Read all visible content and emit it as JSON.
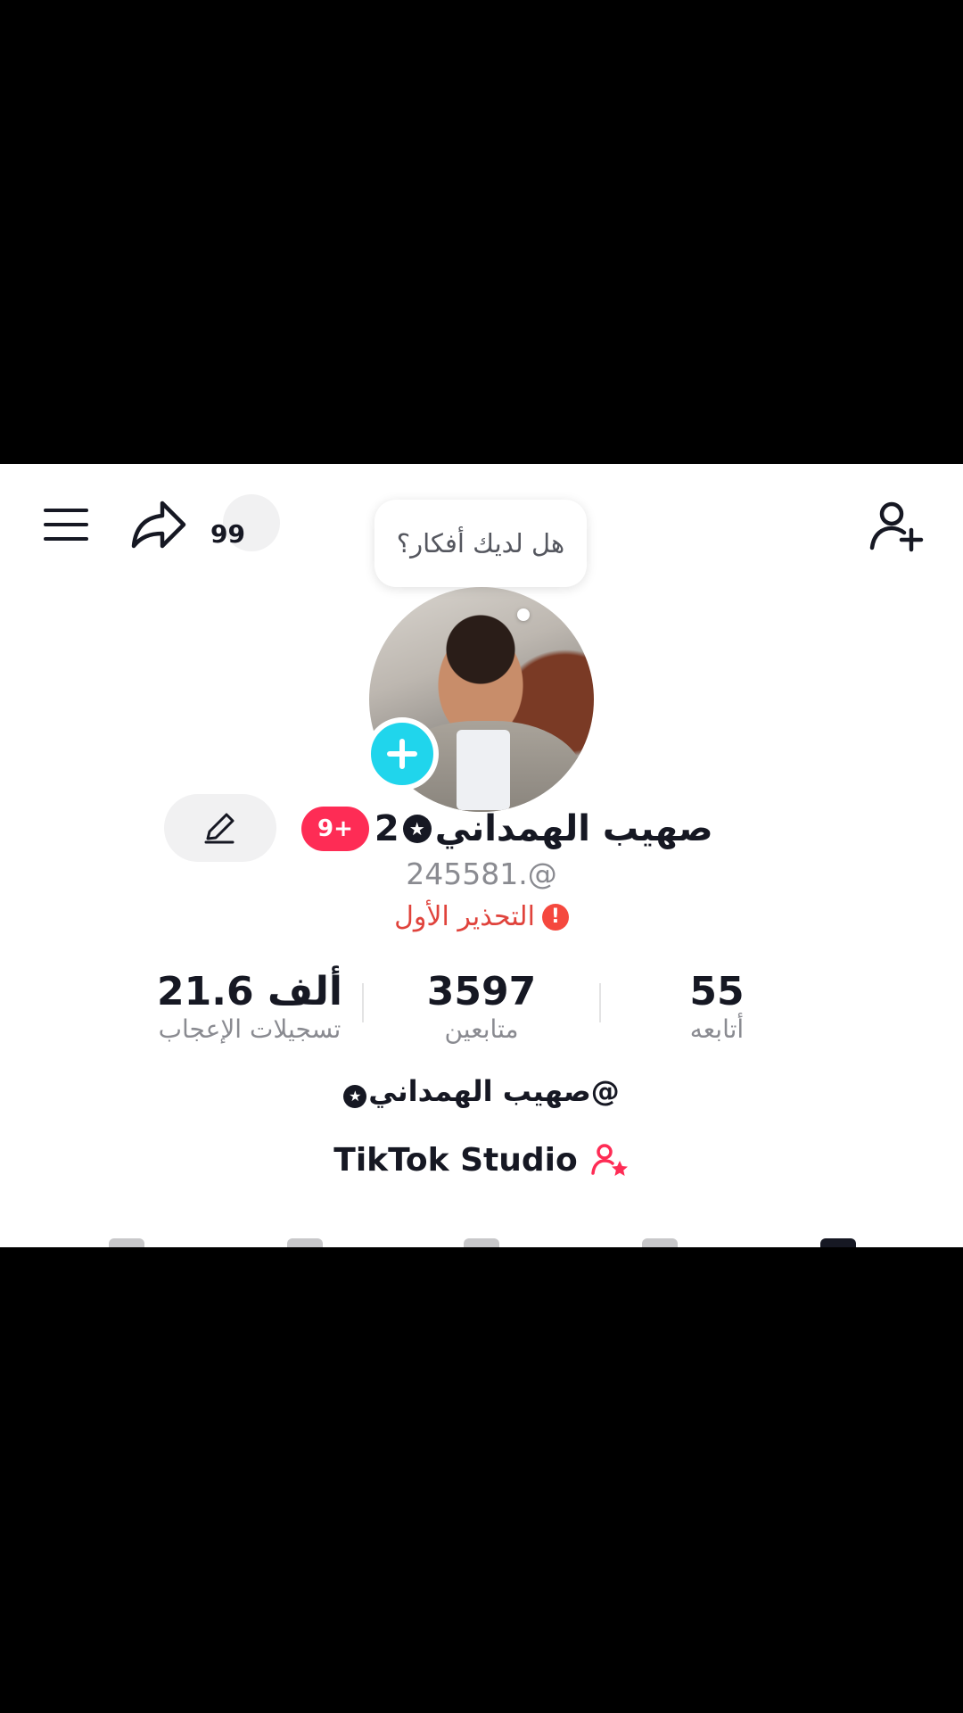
{
  "header": {
    "notification_count": "99",
    "bubble_text": "هل لديك أفكار؟"
  },
  "profile": {
    "display_name": "صهيب الهمداني",
    "name_suffix": "2",
    "badge": "9+",
    "username": "245581.@",
    "warning": "التحذير الأول"
  },
  "stats": {
    "following_value": "55",
    "following_label": "أتابعه",
    "followers_value": "3597",
    "followers_label": "متابعين",
    "likes_value": "21.6 ألف",
    "likes_label": "تسجيلات الإعجاب"
  },
  "bio": "@صهيب الهمداني",
  "studio_label": "TikTok Studio",
  "icons": {
    "menu": "menu-icon",
    "share": "share-icon",
    "add_friend": "add-friend-icon",
    "edit": "pencil-icon",
    "add_photo": "plus-icon",
    "studio": "user-star-icon"
  },
  "colors": {
    "accent_red": "#fe2c55",
    "add_blue": "#20d5ec",
    "warning_red": "#e0433c"
  }
}
